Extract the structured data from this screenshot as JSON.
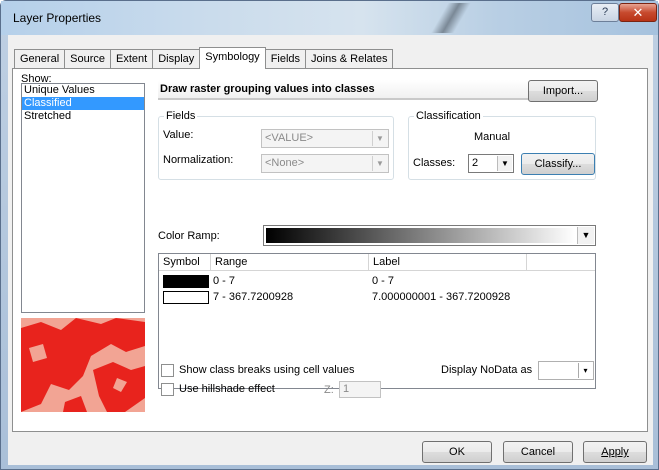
{
  "window": {
    "title": "Layer Properties",
    "help_glyph": "?",
    "close_glyph": "✕"
  },
  "tabs": [
    {
      "label": "General"
    },
    {
      "label": "Source"
    },
    {
      "label": "Extent"
    },
    {
      "label": "Display"
    },
    {
      "label": "Symbology",
      "active": true
    },
    {
      "label": "Fields"
    },
    {
      "label": "Joins & Relates"
    }
  ],
  "show": {
    "label": "Show:",
    "items": [
      {
        "label": "Unique Values"
      },
      {
        "label": "Classified",
        "selected": true
      },
      {
        "label": "Stretched"
      }
    ]
  },
  "heading": "Draw raster grouping values into classes",
  "import_button": "Import...",
  "fields": {
    "title": "Fields",
    "value_label": "Value:",
    "value_selected": "<VALUE>",
    "normalization_label": "Normalization:",
    "normalization_selected": "<None>"
  },
  "classification": {
    "title": "Classification",
    "method": "Manual",
    "classes_label": "Classes:",
    "classes_value": "2",
    "classify_button": "Classify..."
  },
  "color_ramp": {
    "label": "Color Ramp:"
  },
  "table": {
    "headers": [
      "Symbol",
      "Range",
      "Label"
    ],
    "rows": [
      {
        "color": "#000000",
        "range": "0 - 7",
        "label": "0 - 7"
      },
      {
        "color": "#ffffff",
        "range": "7 - 367.7200928",
        "label": "7.000000001 - 367.7200928"
      }
    ]
  },
  "options": {
    "show_class_breaks": "Show class breaks using cell values",
    "use_hillshade": "Use hillshade effect",
    "z_label": "Z:",
    "z_value": "1",
    "nodata_label": "Display NoData as"
  },
  "buttons": {
    "ok": "OK",
    "cancel": "Cancel",
    "apply": "Apply"
  },
  "colors": {
    "selection": "#3399ff",
    "preview_dark": "#e8231d",
    "preview_light": "#f2a494"
  }
}
